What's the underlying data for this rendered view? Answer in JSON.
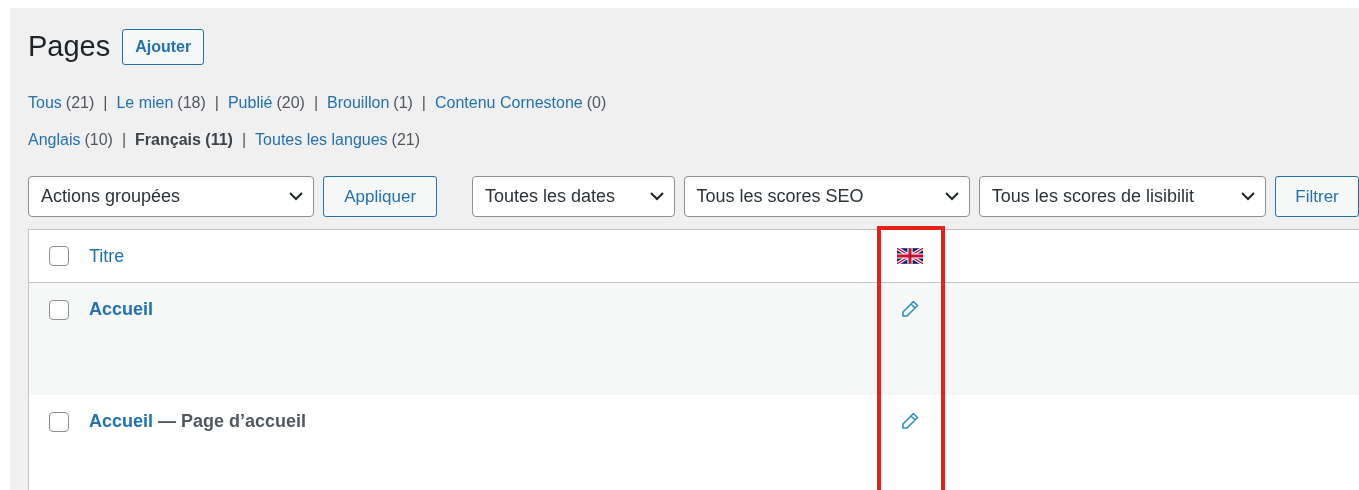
{
  "header": {
    "title": "Pages",
    "add_button": "Ajouter"
  },
  "status_views": [
    {
      "label": "Tous",
      "count": "(21)",
      "selected": false
    },
    {
      "separator_before": "|",
      "label": "Le mien",
      "count": "(18)",
      "selected": false
    },
    {
      "separator_before": "|",
      "label": "Publié",
      "count": "(20)",
      "selected": false
    },
    {
      "separator_before": "|",
      "label": "Brouillon",
      "count": "(1)",
      "selected": false
    },
    {
      "separator_before": "|",
      "label": "Contenu Cornestone",
      "count": "(0)",
      "selected": false
    }
  ],
  "language_views": [
    {
      "label": "Anglais",
      "count": "(10)",
      "selected": false
    },
    {
      "separator_before": "|",
      "label": "Français",
      "count": "(11)",
      "selected": true
    },
    {
      "separator_before": "|",
      "label": "Toutes les langues",
      "count": "(21)",
      "selected": false
    }
  ],
  "toolbar": [
    {
      "kind": "select",
      "value": "Actions groupées"
    },
    {
      "kind": "button",
      "label": "Appliquer"
    },
    {
      "kind": "gap"
    },
    {
      "kind": "select",
      "value": "Toutes les dates"
    },
    {
      "kind": "select",
      "value": "Tous les scores SEO"
    },
    {
      "kind": "select",
      "value": "Tous les scores de lisibilit"
    },
    {
      "kind": "button",
      "label": "Filtrer"
    }
  ],
  "table": {
    "select_all_checked": false,
    "columns": [
      {
        "label": "Titre",
        "kind": "title"
      },
      {
        "kind": "flag"
      }
    ],
    "rows": [
      {
        "title": "Accueil",
        "checked": false
      },
      {
        "title": "Accueil",
        "state": "— Page d’accueil",
        "checked": false
      }
    ]
  }
}
